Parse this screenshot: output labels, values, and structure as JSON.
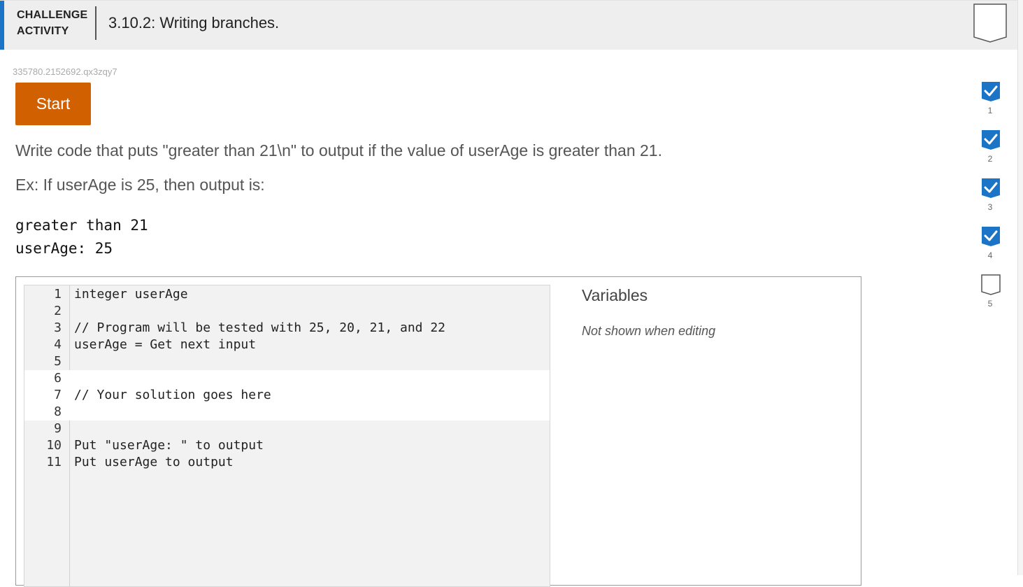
{
  "header": {
    "label": "CHALLENGE ACTIVITY",
    "title": "3.10.2: Writing branches."
  },
  "activity_id": "335780.2152692.qx3zqy7",
  "start_label": "Start",
  "instructions": {
    "main": "Write code that puts \"greater than 21\\n\" to output if the value of userAge is greater than 21.",
    "example": "Ex: If userAge is 25, then output is:"
  },
  "expected_output": [
    "greater than 21",
    "userAge: 25"
  ],
  "code_lines": [
    {
      "num": "1",
      "text": "integer userAge",
      "editable": false
    },
    {
      "num": "2",
      "text": "",
      "editable": false
    },
    {
      "num": "3",
      "text": "// Program will be tested with 25, 20, 21, and 22",
      "editable": false
    },
    {
      "num": "4",
      "text": "userAge = Get next input",
      "editable": false
    },
    {
      "num": "5",
      "text": "",
      "editable": false
    },
    {
      "num": "6",
      "text": "",
      "editable": true
    },
    {
      "num": "7",
      "text": "// Your solution goes here",
      "editable": true
    },
    {
      "num": "8",
      "text": "",
      "editable": true
    },
    {
      "num": "9",
      "text": "",
      "editable": false
    },
    {
      "num": "10",
      "text": "Put \"userAge: \" to output",
      "editable": false
    },
    {
      "num": "11",
      "text": "Put userAge to output",
      "editable": false
    }
  ],
  "variables": {
    "title": "Variables",
    "note": "Not shown when editing"
  },
  "levels": [
    {
      "label": "1",
      "completed": true
    },
    {
      "label": "2",
      "completed": true
    },
    {
      "label": "3",
      "completed": true
    },
    {
      "label": "4",
      "completed": true
    },
    {
      "label": "5",
      "completed": false
    }
  ],
  "colors": {
    "accent": "#1b74c5",
    "start_button": "#d06000",
    "check_complete": "#1b74c5"
  }
}
